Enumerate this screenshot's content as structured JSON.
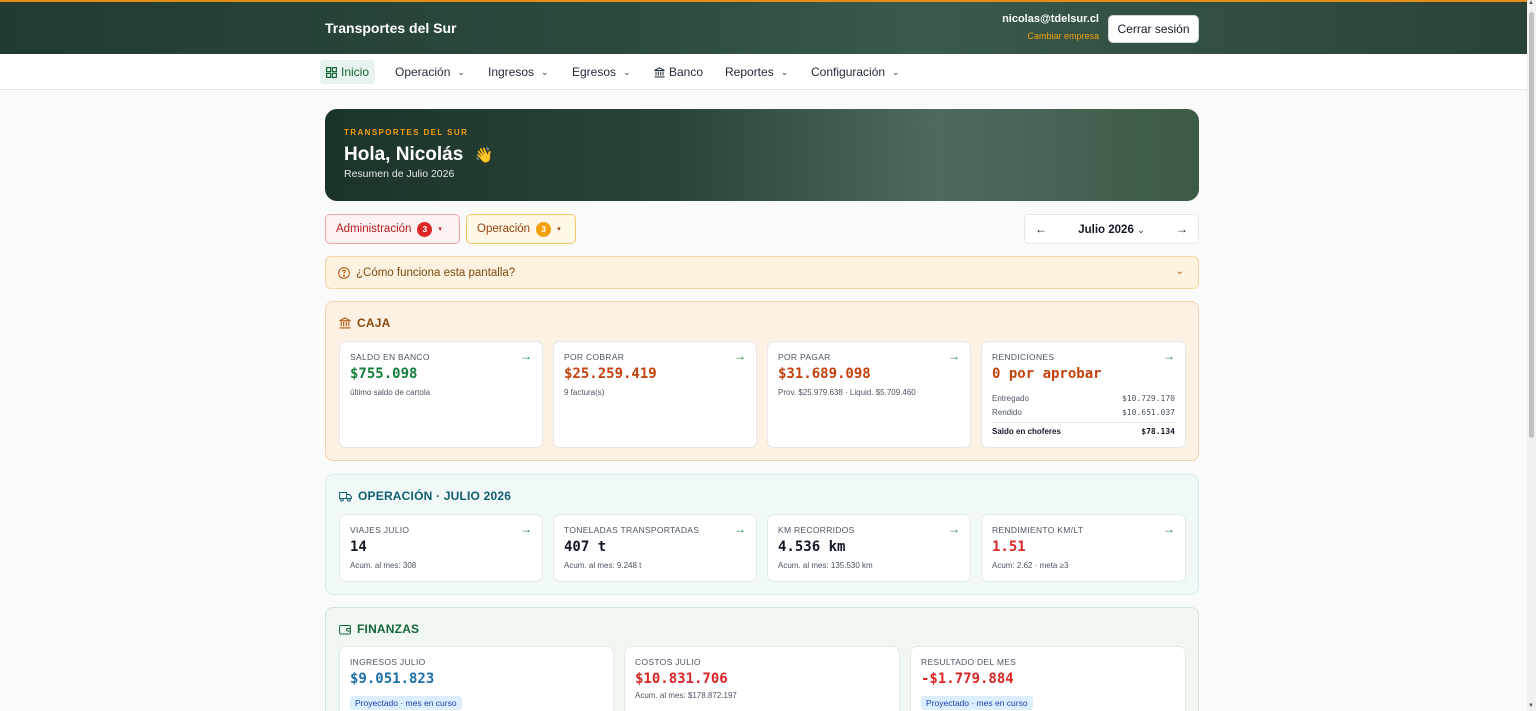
{
  "header": {
    "brand": "Transportes del Sur",
    "email": "nicolas@tdelsur.cl",
    "switch_company": "Cambiar empresa",
    "logout": "Cerrar sesión"
  },
  "nav": {
    "items": [
      {
        "label": "Inicio",
        "icon": "grid-icon",
        "active": true
      },
      {
        "label": "Operación",
        "dropdown": true
      },
      {
        "label": "Ingresos",
        "dropdown": true
      },
      {
        "label": "Egresos",
        "dropdown": true
      },
      {
        "label": "Banco",
        "icon": "bank-icon"
      },
      {
        "label": "Reportes",
        "dropdown": true
      },
      {
        "label": "Configuración",
        "dropdown": true
      }
    ]
  },
  "hero": {
    "kicker": "TRANSPORTES DEL SUR",
    "greeting": "Hola, Nicolás",
    "emoji": "👋",
    "subtitle": "Resumen de Julio 2026"
  },
  "alerts": {
    "admin": {
      "label": "Administración",
      "count": "3"
    },
    "oper": {
      "label": "Operación",
      "count": "3"
    }
  },
  "month_picker": {
    "label": "Julio 2026",
    "prev": "←",
    "next": "→",
    "caret": "⌄"
  },
  "help": {
    "text": "¿Cómo funciona esta pantalla?"
  },
  "caja": {
    "title": "CAJA",
    "cards": [
      {
        "label": "SALDO EN BANCO",
        "value": "$755.098",
        "note": "último saldo de cartola"
      },
      {
        "label": "POR COBRAR",
        "value": "$25.259.419",
        "note": "9 factura(s)"
      },
      {
        "label": "POR PAGAR",
        "value": "$31.689.098",
        "note": "Prov. $25.979.638 · Liquid. $5.709.460"
      },
      {
        "label": "RENDICIONES",
        "value": "0 por aprobar",
        "rows": [
          {
            "label": "Entregado",
            "value": "$10.729.170"
          },
          {
            "label": "Rendido",
            "value": "$10.651.037"
          }
        ],
        "total": {
          "label": "Saldo en choferes",
          "value": "$78.134"
        }
      }
    ]
  },
  "operacion": {
    "title": "OPERACIÓN · JULIO 2026",
    "cards": [
      {
        "label": "VIAJES JULIO",
        "value": "14",
        "note": "Acum. al mes: 308"
      },
      {
        "label": "TONELADAS TRANSPORTADAS",
        "value": "407 t",
        "note": "Acum. al mes: 9.248 t"
      },
      {
        "label": "KM RECORRIDOS",
        "value": "4.536 km",
        "note": "Acum. al mes: 135.530 km"
      },
      {
        "label": "RENDIMIENTO KM/LT",
        "value": "1.51",
        "note": "Acum: 2.62 · meta ≥3"
      }
    ]
  },
  "finanzas": {
    "title": "FINANZAS",
    "cards": [
      {
        "label": "INGRESOS JULIO",
        "value": "$9.051.823",
        "pill": "Proyectado · mes en curso"
      },
      {
        "label": "COSTOS JULIO",
        "value": "$10.831.706",
        "note": "Acum. al mes: $178.872.197"
      },
      {
        "label": "RESULTADO DEL MES",
        "value": "-$1.779.884",
        "pill": "Proyectado · mes en curso"
      }
    ]
  },
  "colors": {
    "accent": "#e38b1f",
    "header_bg": "#223b31",
    "positive": "#15803d",
    "negative": "#dc2626",
    "warning": "#c2410c"
  }
}
